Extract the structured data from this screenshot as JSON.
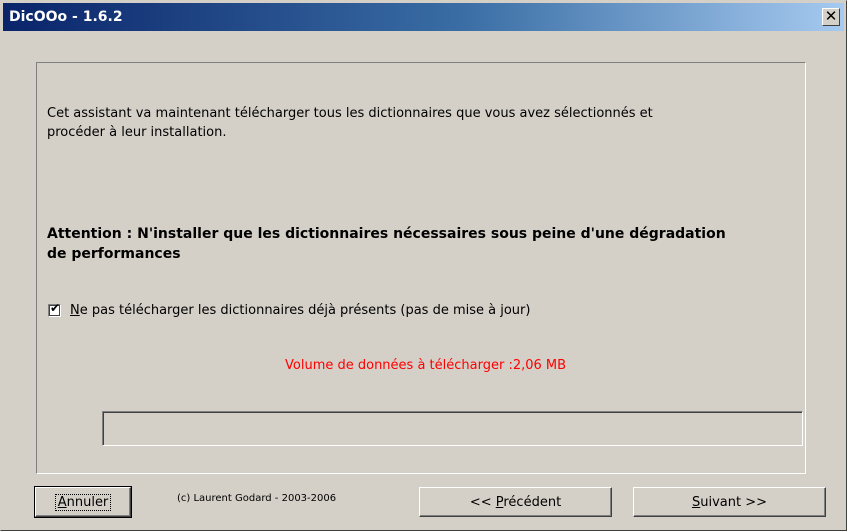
{
  "window": {
    "title": "DicOOo - 1.6.2",
    "close_glyph": "✕"
  },
  "content": {
    "intro_line1": "Cet assistant va maintenant télécharger tous les dictionnaires que vous avez sélectionnés et",
    "intro_line2": "procéder à leur installation.",
    "warning_line1": "Attention : N'installer que les dictionnaires nécessaires sous peine d'une dégradation",
    "warning_line2": "de performances",
    "checkbox": {
      "checked": true,
      "mnemonic": "N",
      "label_rest": "e pas télécharger les dictionnaires déjà présents (pas de mise à jour)"
    },
    "volume_text": "Volume de données à télécharger :2,06 MB",
    "progress_fraction": 0
  },
  "footer": {
    "cancel_mnemonic": "A",
    "cancel_rest": "nnuler",
    "copyright": "(c) Laurent Godard - 2003-2006",
    "prev_prefix": "<< ",
    "prev_mnemonic": "P",
    "prev_rest": "récédent",
    "next_mnemonic": "S",
    "next_rest": "uivant >>"
  },
  "colors": {
    "titlebar_start": "#0a246a",
    "titlebar_end": "#a6caf0",
    "volume_text": "#ff0000",
    "face": "#d4d0c8"
  }
}
